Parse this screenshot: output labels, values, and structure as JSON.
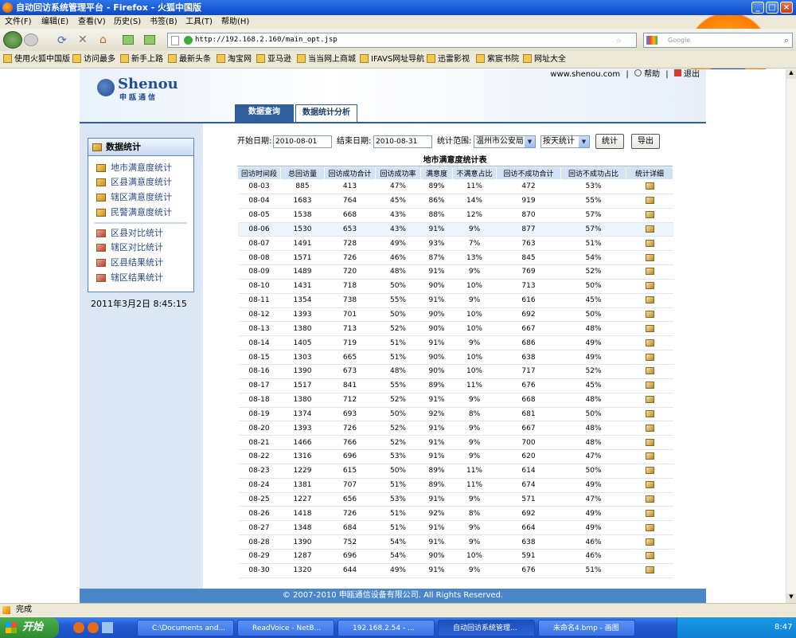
{
  "window": {
    "title": "自动回访系统管理平台 - Firefox - 火狐中国版"
  },
  "menu": [
    "文件(F)",
    "编辑(E)",
    "查看(V)",
    "历史(S)",
    "书签(B)",
    "工具(T)",
    "帮助(H)"
  ],
  "browser": {
    "url": "http://192.168.2.160/main_opt.jsp",
    "search_placeholder": "Google"
  },
  "bookmarks": [
    "使用火狐中国版",
    "访问最多",
    "新手上路",
    "最新头条",
    "淘宝网",
    "亚马逊",
    "当当网上商城",
    "IFAVS网址导航",
    "迅雷影视",
    "紫宸书院",
    "网址大全"
  ],
  "site": {
    "logo_text": "Shenou",
    "logo_sub": "申瓯通信",
    "site_link": "www.shenou.com",
    "help": "帮助",
    "logout": "退出",
    "tabs": [
      "数据查询",
      "数据统计分析"
    ]
  },
  "sidebar": {
    "title": "数据统计",
    "items": [
      "地市满意度统计",
      "区县满意度统计",
      "辖区满意度统计",
      "民警满意度统计",
      "区县对比统计",
      "辖区对比统计",
      "区县结果统计",
      "辖区结果统计"
    ],
    "datetime": "2011年3月2日  8:45:15"
  },
  "filters": {
    "start_label": "开始日期:",
    "start_value": "2010-08-01",
    "end_label": "结束日期:",
    "end_value": "2010-08-31",
    "scope_label": "统计范围:",
    "scope_value": "温州市公安局",
    "period_value": "按天统计",
    "stat_button": "统计",
    "export_button": "导出"
  },
  "table": {
    "title": "地市满意度统计表",
    "columns": [
      "回访时间段",
      "总回访量",
      "回访成功合计",
      "回访成功率",
      "满意度",
      "不满意占比",
      "回访不成功合计",
      "回访不成功占比",
      "统计详细"
    ],
    "rows": [
      [
        "08-03",
        "885",
        "413",
        "47%",
        "89%",
        "11%",
        "472",
        "53%"
      ],
      [
        "08-04",
        "1683",
        "764",
        "45%",
        "86%",
        "14%",
        "919",
        "55%"
      ],
      [
        "08-05",
        "1538",
        "668",
        "43%",
        "88%",
        "12%",
        "870",
        "57%"
      ],
      [
        "08-06",
        "1530",
        "653",
        "43%",
        "91%",
        "9%",
        "877",
        "57%"
      ],
      [
        "08-07",
        "1491",
        "728",
        "49%",
        "93%",
        "7%",
        "763",
        "51%"
      ],
      [
        "08-08",
        "1571",
        "726",
        "46%",
        "87%",
        "13%",
        "845",
        "54%"
      ],
      [
        "08-09",
        "1489",
        "720",
        "48%",
        "91%",
        "9%",
        "769",
        "52%"
      ],
      [
        "08-10",
        "1431",
        "718",
        "50%",
        "90%",
        "10%",
        "713",
        "50%"
      ],
      [
        "08-11",
        "1354",
        "738",
        "55%",
        "91%",
        "9%",
        "616",
        "45%"
      ],
      [
        "08-12",
        "1393",
        "701",
        "50%",
        "90%",
        "10%",
        "692",
        "50%"
      ],
      [
        "08-13",
        "1380",
        "713",
        "52%",
        "90%",
        "10%",
        "667",
        "48%"
      ],
      [
        "08-14",
        "1405",
        "719",
        "51%",
        "91%",
        "9%",
        "686",
        "49%"
      ],
      [
        "08-15",
        "1303",
        "665",
        "51%",
        "90%",
        "10%",
        "638",
        "49%"
      ],
      [
        "08-16",
        "1390",
        "673",
        "48%",
        "90%",
        "10%",
        "717",
        "52%"
      ],
      [
        "08-17",
        "1517",
        "841",
        "55%",
        "89%",
        "11%",
        "676",
        "45%"
      ],
      [
        "08-18",
        "1380",
        "712",
        "52%",
        "91%",
        "9%",
        "668",
        "48%"
      ],
      [
        "08-19",
        "1374",
        "693",
        "50%",
        "92%",
        "8%",
        "681",
        "50%"
      ],
      [
        "08-20",
        "1393",
        "726",
        "52%",
        "91%",
        "9%",
        "667",
        "48%"
      ],
      [
        "08-21",
        "1466",
        "766",
        "52%",
        "91%",
        "9%",
        "700",
        "48%"
      ],
      [
        "08-22",
        "1316",
        "696",
        "53%",
        "91%",
        "9%",
        "620",
        "47%"
      ],
      [
        "08-23",
        "1229",
        "615",
        "50%",
        "89%",
        "11%",
        "614",
        "50%"
      ],
      [
        "08-24",
        "1381",
        "707",
        "51%",
        "89%",
        "11%",
        "674",
        "49%"
      ],
      [
        "08-25",
        "1227",
        "656",
        "53%",
        "91%",
        "9%",
        "571",
        "47%"
      ],
      [
        "08-26",
        "1418",
        "726",
        "51%",
        "92%",
        "8%",
        "692",
        "49%"
      ],
      [
        "08-27",
        "1348",
        "684",
        "51%",
        "91%",
        "9%",
        "664",
        "49%"
      ],
      [
        "08-28",
        "1390",
        "752",
        "54%",
        "91%",
        "9%",
        "638",
        "46%"
      ],
      [
        "08-29",
        "1287",
        "696",
        "54%",
        "90%",
        "10%",
        "591",
        "46%"
      ],
      [
        "08-30",
        "1320",
        "644",
        "49%",
        "91%",
        "9%",
        "676",
        "51%"
      ]
    ]
  },
  "footer": "© 2007-2010 申瓯通信设备有限公司. All Rights Reserved.",
  "statusbar": "完成",
  "taskbar": {
    "start": "开始",
    "tasks": [
      "C:\\Documents and...",
      "ReadVoice - NetB...",
      "192.168.2.54 - ...",
      "自动回访系统管理...",
      "未命名4.bmp - 画图"
    ],
    "clock": "8:47"
  }
}
